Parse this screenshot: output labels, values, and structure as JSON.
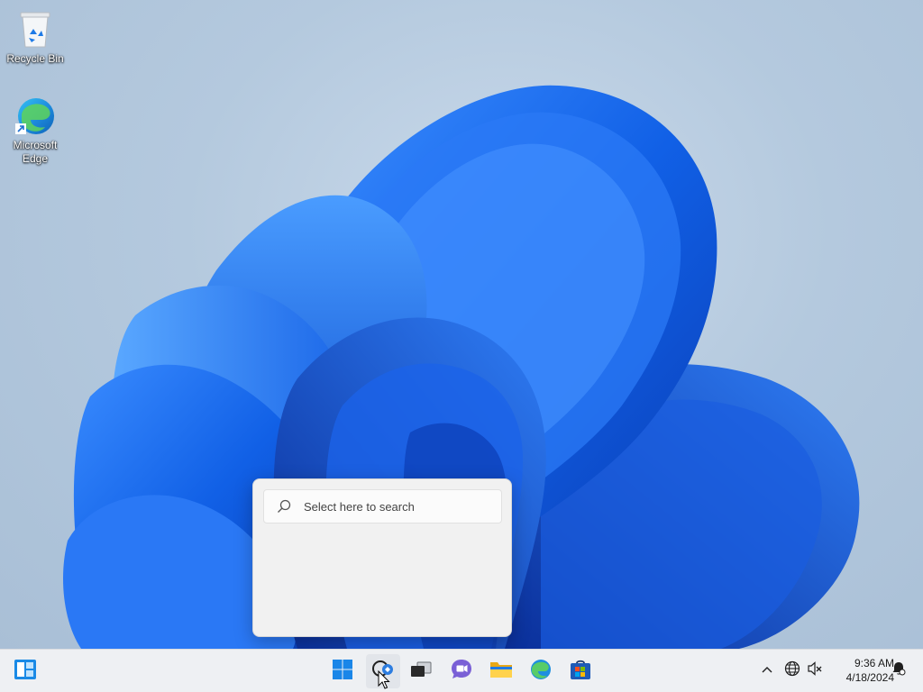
{
  "desktop": {
    "icons": [
      {
        "label": "Recycle Bin",
        "icon": "recycle-bin-icon"
      },
      {
        "label": "Microsoft Edge",
        "icon": "edge-icon"
      }
    ]
  },
  "search_flyout": {
    "placeholder": "Select here to search",
    "icon": "search-icon"
  },
  "taskbar": {
    "left": [
      {
        "name": "widgets",
        "icon": "widgets-icon"
      }
    ],
    "center": [
      {
        "name": "start",
        "icon": "windows-logo-icon"
      },
      {
        "name": "search",
        "icon": "search-icon"
      },
      {
        "name": "task-view",
        "icon": "task-view-icon"
      },
      {
        "name": "chat",
        "icon": "teams-chat-icon"
      },
      {
        "name": "file-explorer",
        "icon": "folder-icon"
      },
      {
        "name": "edge",
        "icon": "edge-icon"
      },
      {
        "name": "store",
        "icon": "store-icon"
      }
    ],
    "tray": [
      {
        "name": "show-hidden",
        "icon": "chevron-up-icon"
      },
      {
        "name": "network",
        "icon": "globe-icon"
      },
      {
        "name": "volume",
        "icon": "speaker-muted-icon"
      }
    ],
    "clock": {
      "time": "9:36 AM",
      "date": "4/18/2024"
    },
    "notification_icon": "notification-icon"
  },
  "colors": {
    "accent": "#0067c0",
    "taskbar": "#eef0f3",
    "flyout": "#f1f1f1"
  }
}
